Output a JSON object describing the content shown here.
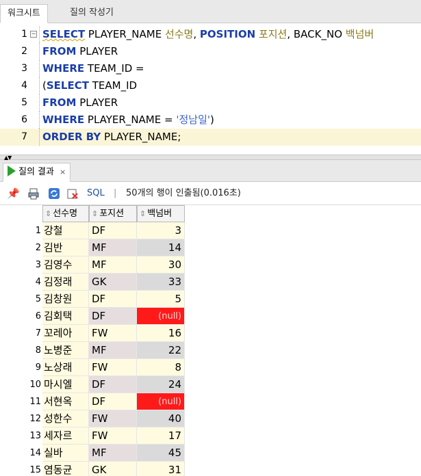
{
  "tabs": [
    {
      "label": "워크시트"
    },
    {
      "label": "질의 작성기"
    }
  ],
  "editor": {
    "lines": [
      {
        "n": "1",
        "tokens": [
          {
            "t": "SELECT",
            "k": "kw squig"
          },
          {
            "t": " PLAYER_NAME ",
            "k": "plain"
          },
          {
            "t": "선수명",
            "k": "alias"
          },
          {
            "t": ", ",
            "k": "plain"
          },
          {
            "t": "POSITION",
            "k": "kw"
          },
          {
            "t": " ",
            "k": "plain"
          },
          {
            "t": "포지션",
            "k": "alias"
          },
          {
            "t": ", BACK_NO ",
            "k": "plain"
          },
          {
            "t": "백넘버",
            "k": "alias"
          }
        ]
      },
      {
        "n": "2",
        "tokens": [
          {
            "t": "FROM",
            "k": "kw"
          },
          {
            "t": " PLAYER",
            "k": "plain"
          }
        ]
      },
      {
        "n": "3",
        "tokens": [
          {
            "t": "WHERE",
            "k": "kw"
          },
          {
            "t": " TEAM_ID =",
            "k": "plain"
          }
        ]
      },
      {
        "n": "4",
        "tokens": [
          {
            "t": "(",
            "k": "plain"
          },
          {
            "t": "SELECT",
            "k": "kw"
          },
          {
            "t": " TEAM_ID",
            "k": "plain"
          }
        ]
      },
      {
        "n": "5",
        "tokens": [
          {
            "t": "FROM",
            "k": "kw"
          },
          {
            "t": " PLAYER",
            "k": "plain"
          }
        ]
      },
      {
        "n": "6",
        "tokens": [
          {
            "t": "WHERE",
            "k": "kw"
          },
          {
            "t": " PLAYER_NAME = ",
            "k": "plain"
          },
          {
            "t": "'정남일'",
            "k": "str"
          },
          {
            "t": ")",
            "k": "plain"
          }
        ]
      },
      {
        "n": "7",
        "tokens": [
          {
            "t": "ORDER BY",
            "k": "kw"
          },
          {
            "t": " PLAYER_NAME;",
            "k": "plain"
          }
        ],
        "current": true
      }
    ]
  },
  "results_tab": {
    "label": "질의 결과",
    "close": "×"
  },
  "toolbar": {
    "sql_label": "SQL",
    "separator": "|",
    "status": "50개의 행이 인출됨(0.016초)",
    "icons": [
      "pin-icon",
      "print-icon",
      "refresh-icon",
      "export-icon"
    ]
  },
  "grid": {
    "columns": [
      "선수명",
      "포지션",
      "백넘버"
    ],
    "sort_icon": "⇕",
    "null_text": "(null)",
    "rows": [
      {
        "n": "1",
        "name": "강철",
        "pos": "DF",
        "no": "3"
      },
      {
        "n": "2",
        "name": "김반",
        "pos": "MF",
        "no": "14"
      },
      {
        "n": "3",
        "name": "김영수",
        "pos": "MF",
        "no": "30"
      },
      {
        "n": "4",
        "name": "김정래",
        "pos": "GK",
        "no": "33"
      },
      {
        "n": "5",
        "name": "김창원",
        "pos": "DF",
        "no": "5"
      },
      {
        "n": "6",
        "name": "김회택",
        "pos": "DF",
        "no": "(null)"
      },
      {
        "n": "7",
        "name": "꼬레아",
        "pos": "FW",
        "no": "16"
      },
      {
        "n": "8",
        "name": "노병준",
        "pos": "MF",
        "no": "22"
      },
      {
        "n": "9",
        "name": "노상래",
        "pos": "FW",
        "no": "8"
      },
      {
        "n": "10",
        "name": "마시엘",
        "pos": "DF",
        "no": "24"
      },
      {
        "n": "11",
        "name": "서현옥",
        "pos": "DF",
        "no": "(null)"
      },
      {
        "n": "12",
        "name": "성한수",
        "pos": "FW",
        "no": "40"
      },
      {
        "n": "13",
        "name": "세자르",
        "pos": "FW",
        "no": "17"
      },
      {
        "n": "14",
        "name": "실바",
        "pos": "MF",
        "no": "45"
      },
      {
        "n": "15",
        "name": "염동균",
        "pos": "GK",
        "no": "31"
      }
    ]
  }
}
